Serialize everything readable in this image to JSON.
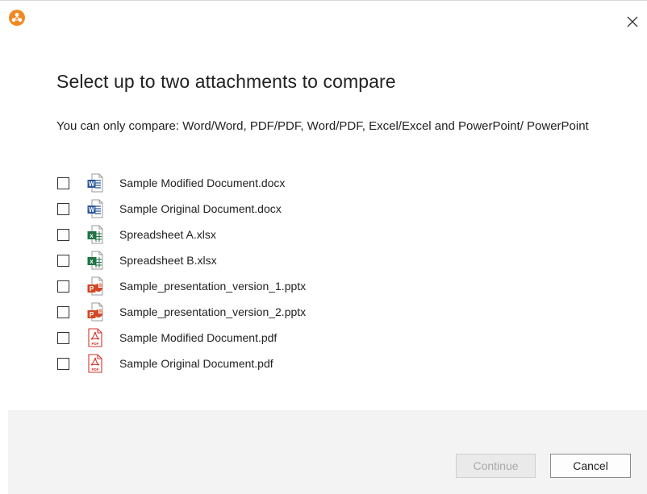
{
  "dialog": {
    "title": "Select up to two attachments to compare",
    "subtitle": "You can only compare: Word/Word, PDF/PDF, Word/PDF, Excel/Excel and PowerPoint/ PowerPoint",
    "accent_color": "#f08a24"
  },
  "files": [
    {
      "name": "Sample Modified Document.docx",
      "icon": "word-icon",
      "checked": false
    },
    {
      "name": "Sample Original Document.docx",
      "icon": "word-icon",
      "checked": false
    },
    {
      "name": "Spreadsheet A.xlsx",
      "icon": "excel-icon",
      "checked": false
    },
    {
      "name": "Spreadsheet B.xlsx",
      "icon": "excel-icon",
      "checked": false
    },
    {
      "name": "Sample_presentation_version_1.pptx",
      "icon": "powerpoint-icon",
      "checked": false
    },
    {
      "name": "Sample_presentation_version_2.pptx",
      "icon": "powerpoint-icon",
      "checked": false
    },
    {
      "name": "Sample Modified Document.pdf",
      "icon": "pdf-icon",
      "checked": false
    },
    {
      "name": "Sample Original Document.pdf",
      "icon": "pdf-icon",
      "checked": false
    }
  ],
  "buttons": {
    "continue_label": "Continue",
    "continue_enabled": false,
    "cancel_label": "Cancel"
  }
}
